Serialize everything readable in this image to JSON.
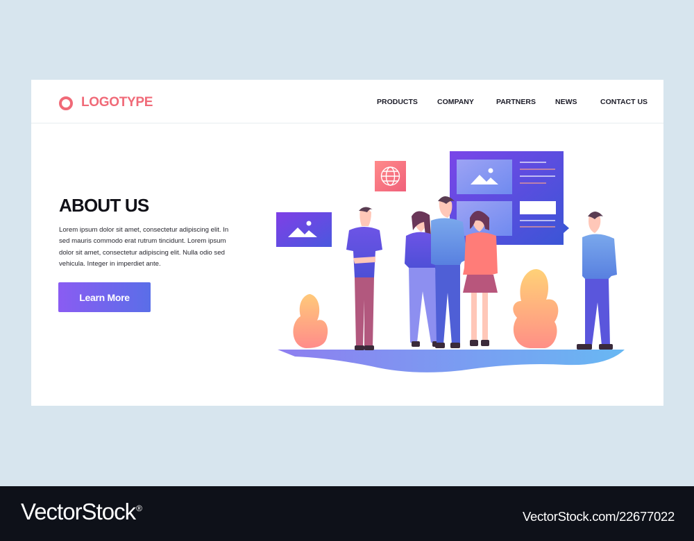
{
  "header": {
    "logo_text": "LOGOTYPE",
    "nav": [
      "PRODUCTS",
      "COMPANY",
      "PARTNERS",
      "NEWS",
      "CONTACT US"
    ]
  },
  "hero": {
    "title": "ABOUT US",
    "body": "Lorem ipsum dolor sit amet, consectetur adipiscing elit. In sed mauris commodo erat rutrum tincidunt. Lorem ipsum dolor sit amet, consectetur adipiscing elit. Nulla  odio sed vehicula. Integer in imperdiet ante.",
    "button_label": "Learn More"
  },
  "illustration": {
    "icons": [
      "image-icon",
      "globe-icon",
      "image-icon"
    ]
  },
  "footer": {
    "brand": "VectorStock",
    "trademark": "®",
    "reference": "VectorStock.com/22677022"
  },
  "colors": {
    "background": "#d7e5ee",
    "logo": "#f06a78",
    "accent_purple": "#8a5cf2",
    "accent_blue": "#5a6ee8",
    "footer": "#0e1119"
  }
}
